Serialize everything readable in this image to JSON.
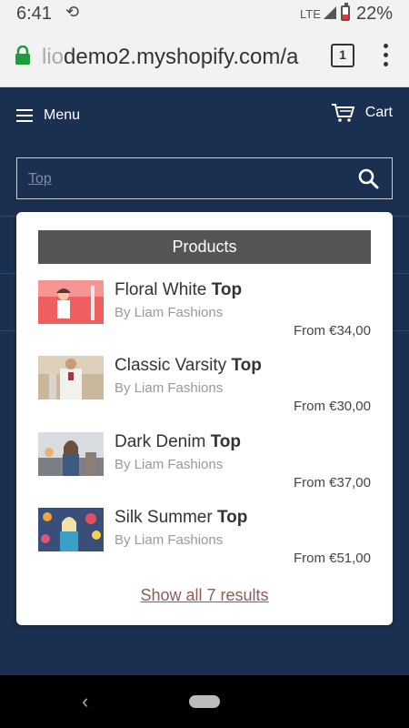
{
  "status_bar": {
    "time": "6:41",
    "network": "LTE",
    "battery": "22%"
  },
  "browser": {
    "url_faded": "lio",
    "url_main": "demo2.myshopify.com/a",
    "tab_count": "1"
  },
  "header": {
    "menu_label": "Menu",
    "cart_label": "Cart"
  },
  "search": {
    "value": "Top"
  },
  "dropdown": {
    "section_title": "Products",
    "results": [
      {
        "name": "Floral White",
        "match": "Top",
        "vendor": "By Liam Fashions",
        "price": "From €34,00"
      },
      {
        "name": "Classic Varsity",
        "match": "Top",
        "vendor": "By Liam Fashions",
        "price": "From €30,00"
      },
      {
        "name": "Dark Denim",
        "match": "Top",
        "vendor": "By Liam Fashions",
        "price": "From €37,00"
      },
      {
        "name": "Silk Summer",
        "match": "Top",
        "vendor": "By Liam Fashions",
        "price": "From €51,00"
      }
    ],
    "show_all": "Show all 7 results"
  },
  "colors": {
    "page_background": "#1b2f50",
    "dropdown_header": "#555555",
    "show_all_link": "#8e5b57"
  }
}
